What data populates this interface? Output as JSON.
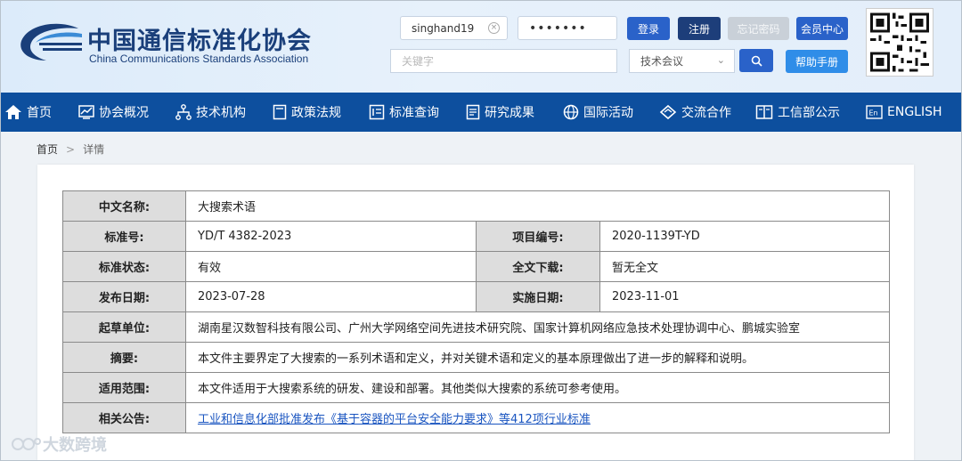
{
  "header": {
    "logo_cn": "中国通信标准化协会",
    "logo_en": "China Communications Standards Association",
    "username_value": "singhand19",
    "password_mask": "•••••••",
    "search_placeholder": "关键字",
    "search_type_selected": "技术会议",
    "login_label": "登录",
    "register_label": "注册",
    "forget_label": "忘记密码",
    "member_label": "会员中心",
    "help_label": "帮助手册"
  },
  "nav": [
    {
      "label": "首页",
      "icon": "home-icon"
    },
    {
      "label": "协会概况",
      "icon": "chart-icon"
    },
    {
      "label": "技术机构",
      "icon": "org-tree-icon"
    },
    {
      "label": "政策法规",
      "icon": "document-icon"
    },
    {
      "label": "标准查询",
      "icon": "search-doc-icon"
    },
    {
      "label": "研究成果",
      "icon": "report-icon"
    },
    {
      "label": "国际活动",
      "icon": "globe-icon"
    },
    {
      "label": "交流合作",
      "icon": "handshake-icon"
    },
    {
      "label": "工信部公示",
      "icon": "book-icon"
    },
    {
      "label": "ENGLISH",
      "icon": "en-icon"
    }
  ],
  "breadcrumb": {
    "home": "首页",
    "separator": ">",
    "current": "详情"
  },
  "detail": {
    "name_label": "中文名称:",
    "name_value": "大搜索术语",
    "std_no_label": "标准号:",
    "std_no_value": "YD/T 4382-2023",
    "project_label": "项目编号:",
    "project_value": "2020-1139T-YD",
    "status_label": "标准状态:",
    "status_value": "有效",
    "download_label": "全文下载:",
    "download_value": "暂无全文",
    "publish_label": "发布日期:",
    "publish_value": "2023-07-28",
    "implement_label": "实施日期:",
    "implement_value": "2023-11-01",
    "drafter_label": "起草单位:",
    "drafter_value": "湖南星汉数智科技有限公司、广州大学网络空间先进技术研究院、国家计算机网络应急技术处理协调中心、鹏城实验室",
    "abstract_label": "摘要:",
    "abstract_value": "本文件主要界定了大搜索的一系列术语和定义，并对关键术语和定义的基本原理做出了进一步的解释和说明。",
    "scope_label": "适用范围:",
    "scope_value": "本文件适用于大搜索系统的研发、建设和部署。其他类似大搜索的系统可参考使用。",
    "notice_label": "相关公告:",
    "notice_value": "工业和信息化部批准发布《基于容器的平台安全能力要求》等412项行业标准"
  },
  "watermark": "大数跨境"
}
